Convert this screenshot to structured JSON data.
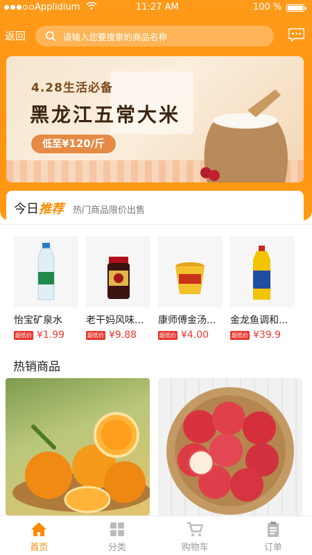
{
  "status_bar": {
    "carrier": "Applidium",
    "time": "11:27 AM",
    "battery": "100 %"
  },
  "header": {
    "back_label": "返回",
    "search_placeholder": "请输入您要搜索的商品名称"
  },
  "banner": {
    "subtitle": "4.28生活必备",
    "title": "黑龙江五常大米",
    "price_prefix": "低至",
    "price": "¥120/斤"
  },
  "recommend": {
    "title_prefix": "今日",
    "title_highlight": "推荐",
    "subtitle": "热门商品限价出售"
  },
  "products": [
    {
      "name": "怡宝矿泉水",
      "tag": "超低价",
      "price": "¥1.99",
      "icon": "water-bottle"
    },
    {
      "name": "老干妈风味...",
      "tag": "超低价",
      "price": "¥9.88",
      "icon": "chili-sauce-jar"
    },
    {
      "name": "康师傅金汤...",
      "tag": "超低价",
      "price": "¥4.00",
      "icon": "instant-noodle-cup"
    },
    {
      "name": "金龙鱼调和...",
      "tag": "超低价",
      "price": "¥39.9",
      "icon": "cooking-oil"
    }
  ],
  "hot": {
    "title": "热销商品"
  },
  "tabs": [
    {
      "label": "首页",
      "active": true,
      "icon": "home-icon"
    },
    {
      "label": "分类",
      "active": false,
      "icon": "grid-icon"
    },
    {
      "label": "购物车",
      "active": false,
      "icon": "cart-icon"
    },
    {
      "label": "订单",
      "active": false,
      "icon": "order-icon"
    }
  ],
  "colors": {
    "accent": "#ff8a00",
    "price_red": "#e8382f"
  }
}
